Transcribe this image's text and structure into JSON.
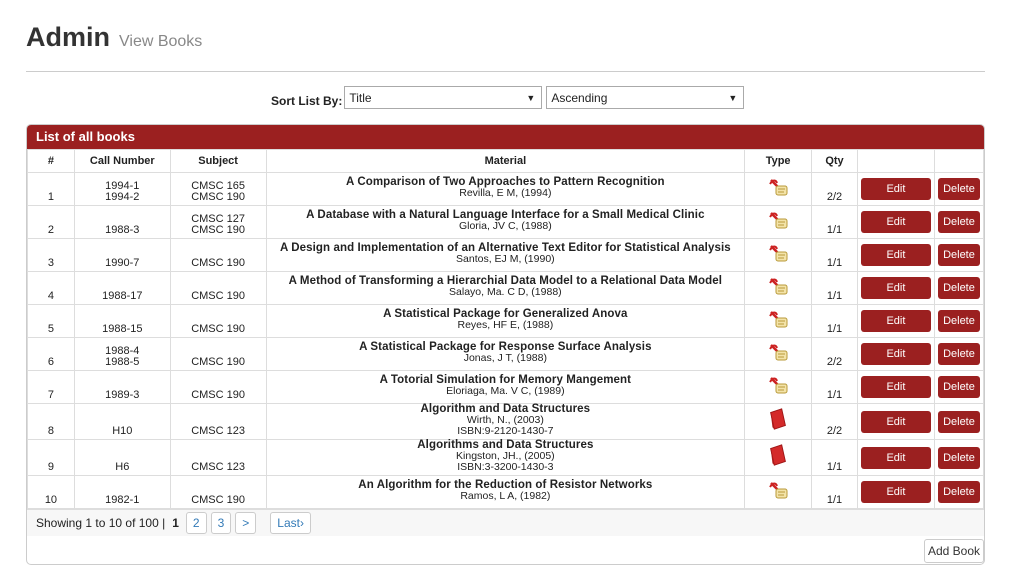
{
  "header": {
    "title": "Admin",
    "subtitle": "View Books"
  },
  "sort": {
    "label": "Sort List By:",
    "field": "Title",
    "order": "Ascending"
  },
  "panel": {
    "title": "List of all books"
  },
  "columns": [
    "#",
    "Call Number",
    "Subject",
    "Material",
    "Type",
    "Qty",
    "",
    ""
  ],
  "rows": [
    {
      "num": "1",
      "call": [
        "1994-1",
        "1994-2"
      ],
      "subject": [
        "CMSC 165",
        "CMSC 190"
      ],
      "title": "A Comparison of Two Approaches to Pattern Recognition",
      "lines": [
        "Revilla, E M, (1994)"
      ],
      "type": "thesis-icon",
      "qty": "2/2"
    },
    {
      "num": "2",
      "call": [
        "1988-3"
      ],
      "subject": [
        "CMSC 127",
        "CMSC 190"
      ],
      "title": "A Database with a Natural Language Interface for a Small Medical Clinic",
      "lines": [
        "Gloria, JV C, (1988)"
      ],
      "type": "thesis-icon",
      "qty": "1/1"
    },
    {
      "num": "3",
      "call": [
        "1990-7"
      ],
      "subject": [
        "CMSC 190"
      ],
      "title": "A Design and Implementation of an Alternative Text Editor for Statistical Analysis",
      "lines": [
        "Santos, EJ M, (1990)"
      ],
      "type": "thesis-icon",
      "qty": "1/1"
    },
    {
      "num": "4",
      "call": [
        "1988-17"
      ],
      "subject": [
        "CMSC 190"
      ],
      "title": "A Method of Transforming a Hierarchial Data Model to a Relational Data Model",
      "lines": [
        "Salayo, Ma. C D, (1988)"
      ],
      "type": "thesis-icon",
      "qty": "1/1"
    },
    {
      "num": "5",
      "call": [
        "1988-15"
      ],
      "subject": [
        "CMSC 190"
      ],
      "title": "A Statistical Package for Generalized Anova",
      "lines": [
        "Reyes, HF E, (1988)"
      ],
      "type": "thesis-icon",
      "qty": "1/1"
    },
    {
      "num": "6",
      "call": [
        "1988-4",
        "1988-5"
      ],
      "subject": [
        "CMSC 190"
      ],
      "title": "A Statistical Package for Response Surface Analysis",
      "lines": [
        "Jonas, J T, (1988)"
      ],
      "type": "thesis-icon",
      "qty": "2/2"
    },
    {
      "num": "7",
      "call": [
        "1989-3"
      ],
      "subject": [
        "CMSC 190"
      ],
      "title": "A Totorial Simulation for Memory Mangement",
      "lines": [
        "Eloriaga, Ma. V C, (1989)"
      ],
      "type": "thesis-icon",
      "qty": "1/1"
    },
    {
      "num": "8",
      "call": [
        "H10"
      ],
      "subject": [
        "CMSC 123"
      ],
      "title": "Algorithm and Data Structures",
      "lines": [
        "Wirth, N., (2003)",
        "ISBN:9-2120-1430-7"
      ],
      "type": "book-icon",
      "qty": "2/2"
    },
    {
      "num": "9",
      "call": [
        "H6"
      ],
      "subject": [
        "CMSC 123"
      ],
      "title": "Algorithms and Data Structures",
      "lines": [
        "Kingston, JH., (2005)",
        "ISBN:3-3200-1430-3"
      ],
      "type": "book-icon",
      "qty": "1/1"
    },
    {
      "num": "10",
      "call": [
        "1982-1"
      ],
      "subject": [
        "CMSC 190"
      ],
      "title": "An Algorithm for the Reduction of Resistor Networks",
      "lines": [
        "Ramos, L A, (1982)"
      ],
      "type": "thesis-icon",
      "qty": "1/1"
    }
  ],
  "actions": {
    "edit": "Edit",
    "delete": "Delete"
  },
  "pager": {
    "summary": "Showing 1 to 10 of 100 |",
    "current": "1",
    "pages": [
      "2",
      "3"
    ],
    "next": ">",
    "last": "Last›"
  },
  "footer": {
    "add": "Add Book"
  },
  "colors": {
    "accent": "#9b2020"
  }
}
